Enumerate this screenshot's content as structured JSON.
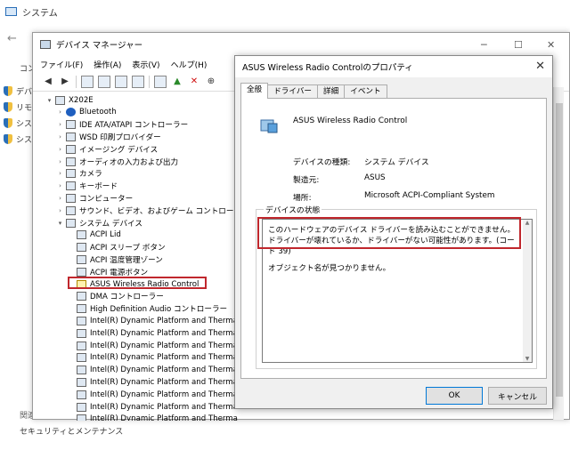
{
  "background": {
    "title": "システム",
    "side_items": [
      "デバ",
      "リモ",
      "シス",
      "シス"
    ],
    "text_co": "コン",
    "bottom1": "関連",
    "bottom2": "セキュリティとメンテナンス",
    "nav_back": "←"
  },
  "device_manager": {
    "title": "デバイス マネージャー",
    "menu": [
      "ファイル(F)",
      "操作(A)",
      "表示(V)",
      "ヘルプ(H)"
    ],
    "controls": {
      "minimize": "─",
      "maximize": "☐",
      "close": "✕"
    },
    "tree": [
      {
        "label": "X202E",
        "level": 0,
        "arrow": "▾",
        "icon": "computer"
      },
      {
        "label": "Bluetooth",
        "level": 1,
        "arrow": "›",
        "icon": "bluetooth"
      },
      {
        "label": "IDE ATA/ATAPI コントローラー",
        "level": 1,
        "arrow": "›",
        "icon": "device"
      },
      {
        "label": "WSD 印刷プロバイダー",
        "level": 1,
        "arrow": "›",
        "icon": "device"
      },
      {
        "label": "イメージング デバイス",
        "level": 1,
        "arrow": "›",
        "icon": "device"
      },
      {
        "label": "オーディオの入力および出力",
        "level": 1,
        "arrow": "›",
        "icon": "device"
      },
      {
        "label": "カメラ",
        "level": 1,
        "arrow": "›",
        "icon": "device"
      },
      {
        "label": "キーボード",
        "level": 1,
        "arrow": "›",
        "icon": "device"
      },
      {
        "label": "コンピューター",
        "level": 1,
        "arrow": "›",
        "icon": "device"
      },
      {
        "label": "サウンド、ビデオ、およびゲーム コントローラー",
        "level": 1,
        "arrow": "›",
        "icon": "device"
      },
      {
        "label": "システム デバイス",
        "level": 1,
        "arrow": "▾",
        "icon": "device"
      },
      {
        "label": "ACPI Lid",
        "level": 2,
        "arrow": "",
        "icon": "device"
      },
      {
        "label": "ACPI スリープ ボタン",
        "level": 2,
        "arrow": "",
        "icon": "device"
      },
      {
        "label": "ACPI 温度管理ゾーン",
        "level": 2,
        "arrow": "",
        "icon": "device"
      },
      {
        "label": "ACPI 電源ボタン",
        "level": 2,
        "arrow": "",
        "icon": "device"
      },
      {
        "label": "ASUS Wireless Radio Control",
        "level": 2,
        "arrow": "",
        "icon": "warn"
      },
      {
        "label": "DMA コントローラー",
        "level": 2,
        "arrow": "",
        "icon": "device"
      },
      {
        "label": "High Definition Audio コントローラー",
        "level": 2,
        "arrow": "",
        "icon": "device"
      },
      {
        "label": "Intel(R) Dynamic Platform and Thermal F",
        "level": 2,
        "arrow": "",
        "icon": "device"
      },
      {
        "label": "Intel(R) Dynamic Platform and Thermal F",
        "level": 2,
        "arrow": "",
        "icon": "device"
      },
      {
        "label": "Intel(R) Dynamic Platform and Thermal F",
        "level": 2,
        "arrow": "",
        "icon": "device"
      },
      {
        "label": "Intel(R) Dynamic Platform and Thermal F",
        "level": 2,
        "arrow": "",
        "icon": "device"
      },
      {
        "label": "Intel(R) Dynamic Platform and Thermal F",
        "level": 2,
        "arrow": "",
        "icon": "device"
      },
      {
        "label": "Intel(R) Dynamic Platform and Thermal F",
        "level": 2,
        "arrow": "",
        "icon": "device"
      },
      {
        "label": "Intel(R) Dynamic Platform and Thermal F",
        "level": 2,
        "arrow": "",
        "icon": "device"
      },
      {
        "label": "Intel(R) Dynamic Platform and Thermal F",
        "level": 2,
        "arrow": "",
        "icon": "device"
      },
      {
        "label": "Intel(R) Dynamic Platform and Thermal F",
        "level": 2,
        "arrow": "",
        "icon": "device"
      }
    ]
  },
  "dialog": {
    "title": "ASUS Wireless Radio Controlのプロパティ",
    "close": "✕",
    "tabs": [
      "全般",
      "ドライバー",
      "詳細",
      "イベント"
    ],
    "device_name": "ASUS Wireless Radio Control",
    "props": [
      {
        "label": "デバイスの種類:",
        "value": "システム デバイス"
      },
      {
        "label": "製造元:",
        "value": "ASUS"
      },
      {
        "label": "場所:",
        "value": "Microsoft ACPI-Compliant System"
      }
    ],
    "status_legend": "デバイスの状態",
    "status_message": "このハードウェアのデバイス ドライバーを読み込むことができません。ドライバーが壊れているか、ドライバーがない可能性があります。(コード 39)",
    "status_extra": "オブジェクト名が見つかりません。",
    "ok_label": "OK",
    "cancel_label": "キャンセル"
  },
  "colors": {
    "accent": "#0078d7",
    "highlight": "#c0272d"
  }
}
